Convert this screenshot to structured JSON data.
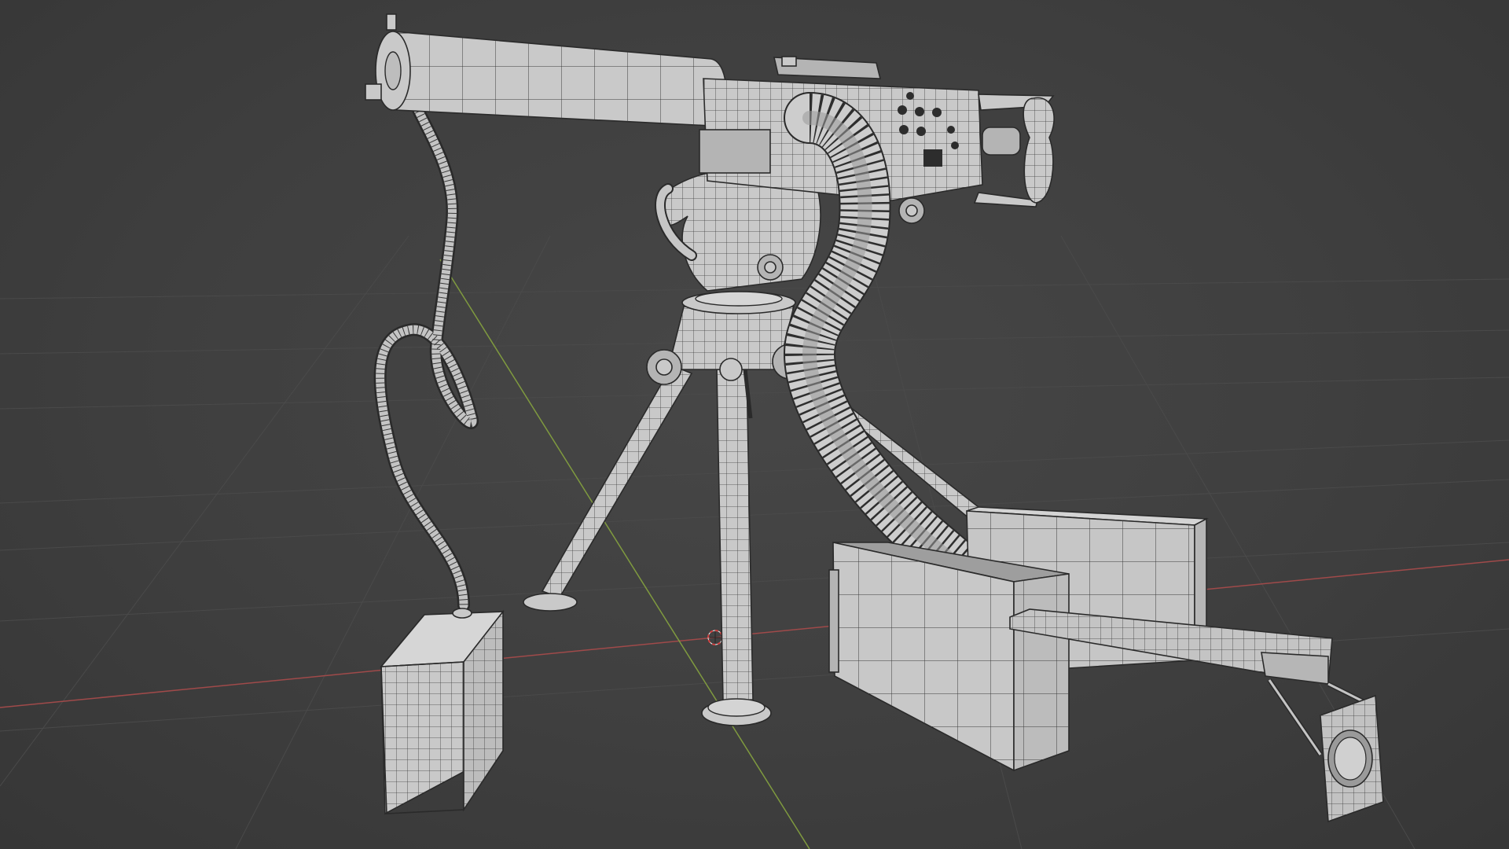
{
  "viewport": {
    "background_color": "#3d3d3d",
    "grid_color": "#4a4a4a",
    "x_axis_color": "#a04a4a",
    "y_axis_color": "#7f9a3f",
    "mesh_face_color": "#c9c9c9",
    "mesh_wire_color": "#2a2a2a",
    "cursor_color": "#d04040"
  },
  "scene": {
    "objects": [
      "machine-gun-barrel",
      "receiver",
      "spade-grip-handle",
      "ammunition-belt",
      "tripod-mount",
      "tripod-leg-left",
      "tripod-leg-front",
      "tripod-leg-rear",
      "coolant-hose",
      "coolant-can",
      "ammo-box-open",
      "ammo-box-closed",
      "feed-tray",
      "target-plate"
    ]
  }
}
